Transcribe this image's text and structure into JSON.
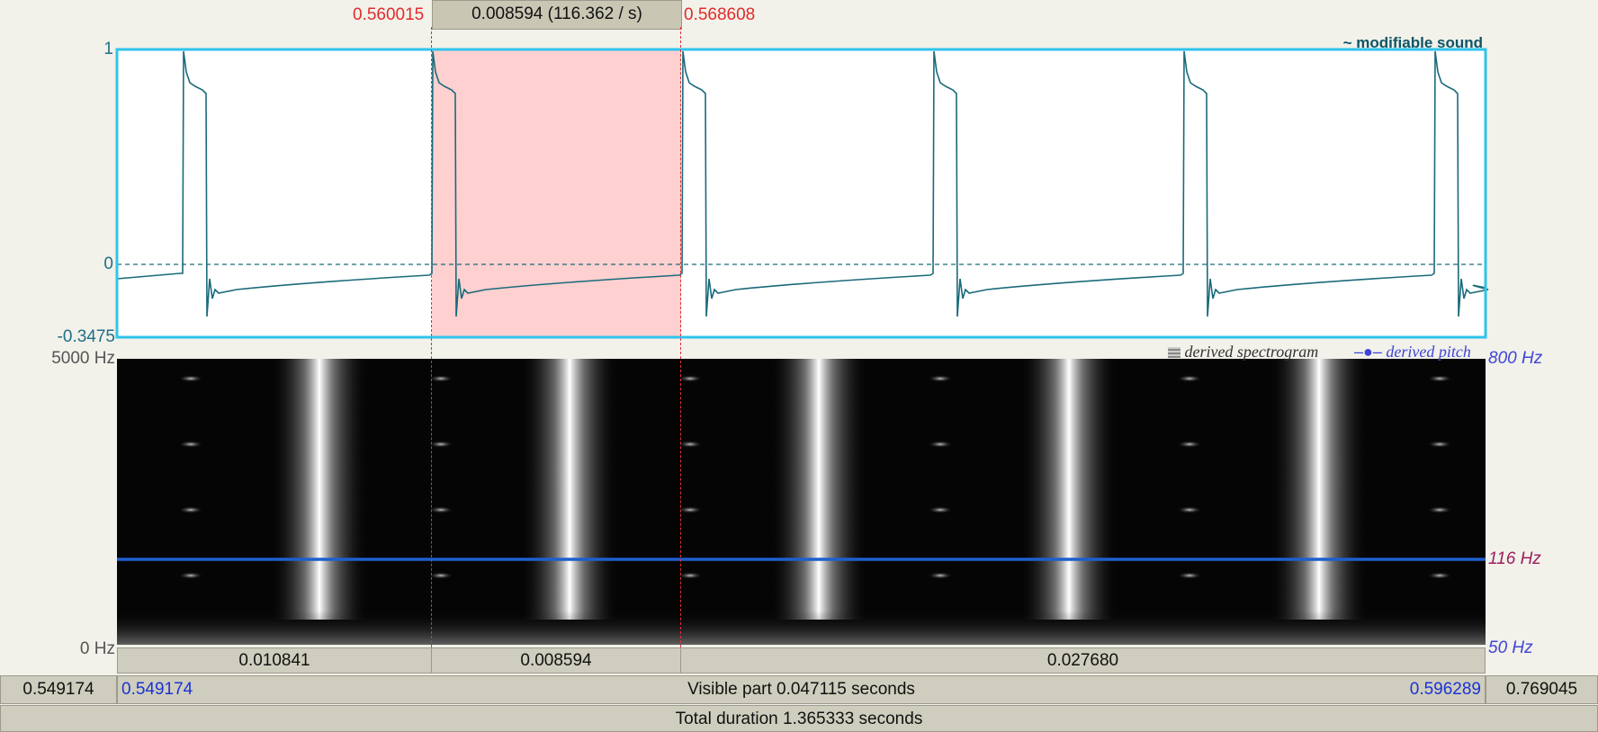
{
  "selection": {
    "start": "0.560015",
    "duration_label": "0.008594 (116.362 / s)",
    "end": "0.568608"
  },
  "waveform": {
    "title": "~ modifiable sound",
    "y_max": "1",
    "y_zero": "0",
    "y_min": "-0.3475"
  },
  "spectrogram": {
    "top_hz": "5000 Hz",
    "bottom_hz": "0 Hz",
    "legend_spectrogram": "derived spectrogram",
    "legend_pitch": "derived pitch",
    "pitch_top": "800 Hz",
    "pitch_value": "116 Hz",
    "pitch_bottom": "50 Hz"
  },
  "segments": [
    "0.010841",
    "0.008594",
    "0.027680"
  ],
  "bottom": {
    "total_start": "0.549174",
    "visible_start": "0.549174",
    "visible_label": "Visible part 0.047115 seconds",
    "visible_end": "0.596289",
    "total_end": "0.769045",
    "total_duration": "Total duration 1.365333 seconds"
  },
  "colors": {
    "waveform_line": "#1a6a7a",
    "frame": "#2fc4ec",
    "selection_fill": "#ffd0d0",
    "cursor": "#e03030",
    "pitch_line": "#1e5fd0"
  }
}
